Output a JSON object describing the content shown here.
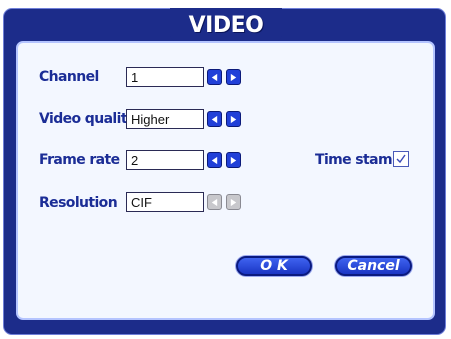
{
  "dialog": {
    "title": "VIDEO"
  },
  "fields": {
    "channel": {
      "label": "Channel",
      "value": "1"
    },
    "video_quality": {
      "label": "Video quality",
      "value": "Higher"
    },
    "frame_rate": {
      "label": "Frame rate",
      "value": "2"
    },
    "resolution": {
      "label": "Resolution",
      "value": "CIF"
    }
  },
  "timestamp": {
    "label": "Time stamp",
    "checked": true
  },
  "buttons": {
    "ok": "O K",
    "cancel": "Cancel"
  },
  "icons": {
    "prev": "arrow-left-icon",
    "next": "arrow-right-icon",
    "check": "checkmark-icon"
  },
  "colors": {
    "frame": "#1c2c8a",
    "panel": "#f3f7ff",
    "label": "#1b2d96",
    "arrow": "#2140d8",
    "arrow_disabled": "#c8c8cc"
  }
}
